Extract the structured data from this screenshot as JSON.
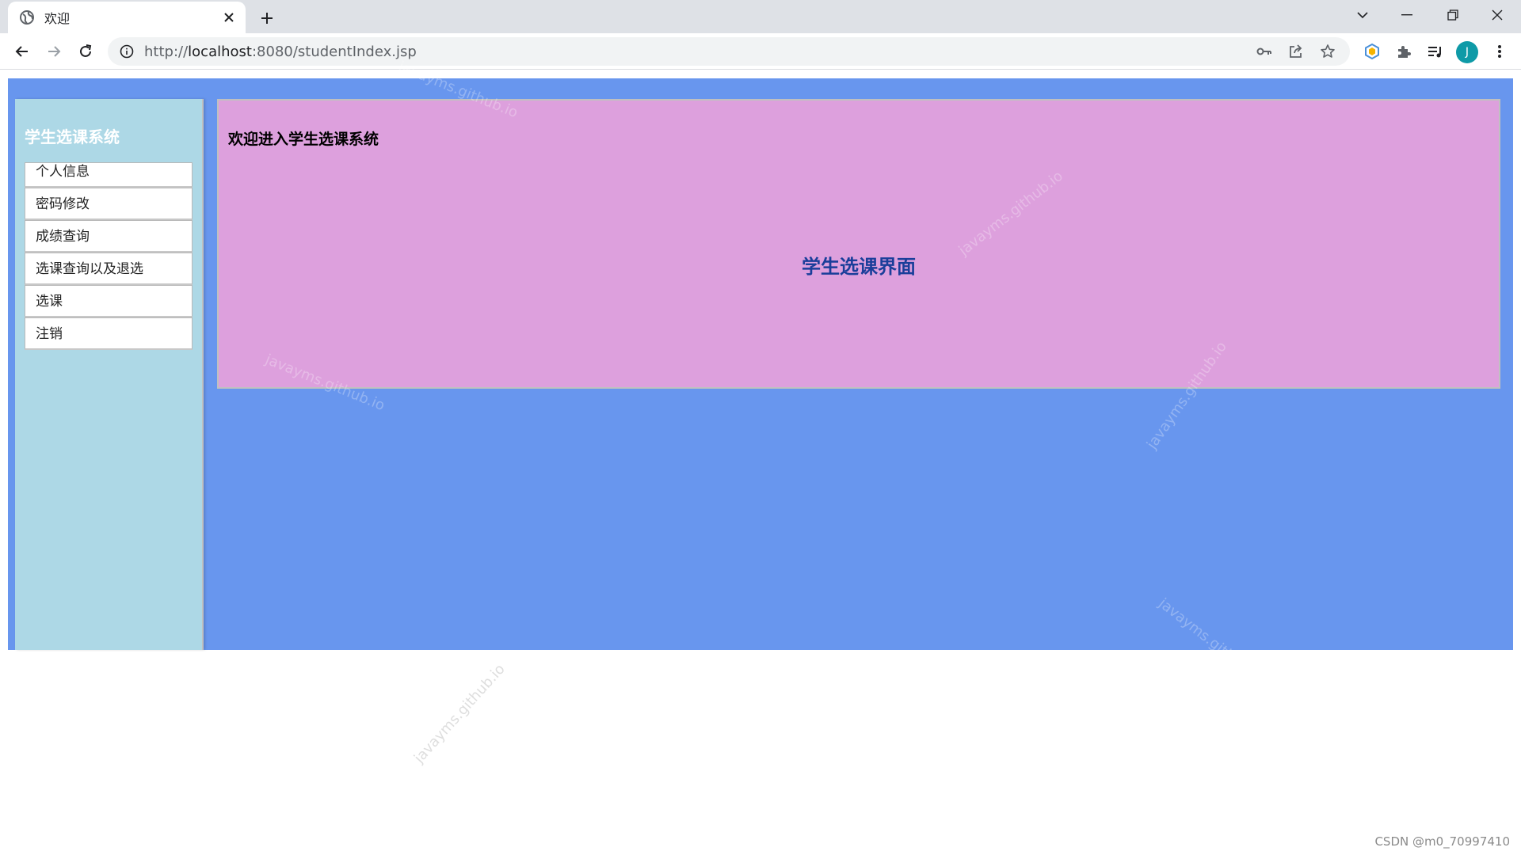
{
  "browser": {
    "tab_title": "欢迎",
    "url_scheme": "http://",
    "url_host": "localhost",
    "url_rest": ":8080/studentIndex.jsp",
    "avatar_letter": "J"
  },
  "sidebar": {
    "title": "学生选课系统",
    "items": [
      {
        "label": "个人信息"
      },
      {
        "label": "密码修改"
      },
      {
        "label": "成绩查询"
      },
      {
        "label": "选课查询以及退选"
      },
      {
        "label": "选课"
      },
      {
        "label": "注销"
      }
    ]
  },
  "content": {
    "welcome": "欢迎进入学生选课系统",
    "heading": "学生选课界面"
  },
  "watermark_text": "javayms.github.io",
  "credit": "CSDN @m0_70997410",
  "colors": {
    "frame_bg": "#6896ee",
    "sidebar_bg": "#add8e6",
    "content_bg": "#dda0dd",
    "heading": "#1a3e9a"
  }
}
